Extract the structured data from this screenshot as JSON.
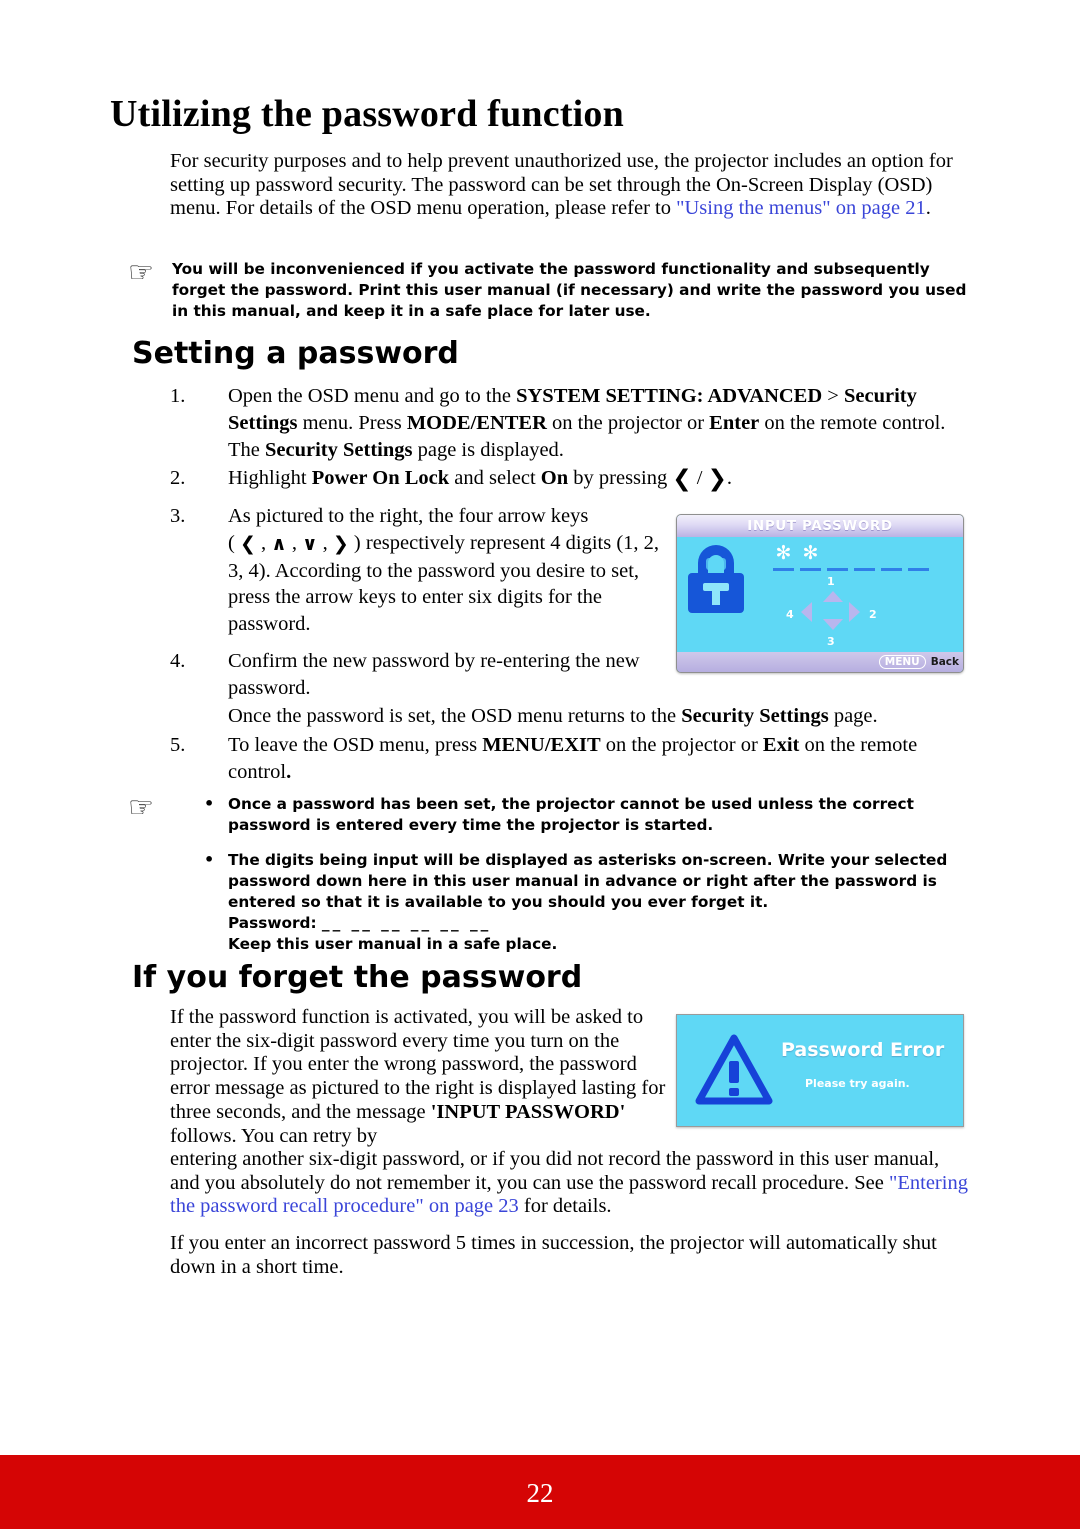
{
  "document": {
    "page_number": "22",
    "accent_color": "#d50505",
    "link_color": "#3a45d8",
    "osd_background": "#5fd8f5"
  },
  "headings": {
    "title": "Utilizing the password function",
    "setting_a_password": "Setting a password",
    "if_you_forget": "If you forget the password"
  },
  "intro": {
    "part1": "For security purposes and to help prevent unauthorized use, the projector includes an option for setting up password security. The password can be set through the On-Screen Display (OSD) menu. For details of the OSD menu operation, please refer to ",
    "link": "\"Using the menus\" on page 21",
    "part2": "."
  },
  "note1": {
    "icon": "pointing-hand-icon",
    "text": "You will be inconvenienced if you activate the password functionality and subsequently forget the password. Print this user manual (if necessary) and write the password you used in this manual, and keep it in a safe place for later use."
  },
  "steps": {
    "step1": {
      "num": "1.",
      "t1": "Open the OSD menu and go to the ",
      "b1": "SYSTEM SETTING: ADVANCED",
      "t2": " > ",
      "b2": "Security Settings",
      "t3": " menu. Press ",
      "b3": "MODE/ENTER",
      "t4": " on the projector or ",
      "b4": "Enter",
      "t5": " on the remote control. The ",
      "b5": "Security Settings",
      "t6": " page is displayed."
    },
    "step2": {
      "num": "2.",
      "t1": "Highlight ",
      "b1": "Power On Lock",
      "t2": " and select ",
      "b2": "On",
      "t3": " by pressing ",
      "arrow_left": "❮",
      "slash": " / ",
      "arrow_right": "❯",
      "t4": "."
    },
    "step3": {
      "num": "3.",
      "t1": "As pictured to the right, the four arrow keys",
      "open_paren": "( ",
      "a_left": "❮",
      "c1": " , ",
      "a_up": "∧",
      "c2": " , ",
      "a_down": "∨",
      "c3": " , ",
      "a_right": "❯",
      "close_paren": " ) ",
      "t2": "respectively represent 4 digits (1, 2, 3, 4). According to the password you desire to set, press the arrow keys to enter six digits for the password."
    },
    "step4": {
      "num": "4.",
      "t1": "Confirm the new password by re-entering the new password."
    },
    "step_once": {
      "t1": "Once the password is set, the OSD menu returns to the ",
      "b1": "Security Settings",
      "t2": " page."
    },
    "step5": {
      "num": "5.",
      "t1": "To leave the OSD menu, press ",
      "b1": "MENU/EXIT",
      "t2": " on the projector or ",
      "b2": "Exit",
      "t3": " on the remote control",
      "t4": "."
    }
  },
  "osd_input_password": {
    "title": "INPUT PASSWORD",
    "lock_icon": "padlock-icon",
    "slots": [
      {
        "filled": true,
        "char": "✻"
      },
      {
        "filled": true,
        "char": "✻"
      },
      {
        "filled": false,
        "char": ""
      },
      {
        "filled": false,
        "char": ""
      },
      {
        "filled": false,
        "char": ""
      },
      {
        "filled": false,
        "char": ""
      }
    ],
    "dpad": {
      "up_label": "1",
      "right_label": "2",
      "down_label": "3",
      "left_label": "4"
    },
    "footer": {
      "menu_key": "MENU",
      "action": "Back"
    }
  },
  "note2": {
    "icon": "pointing-hand-icon",
    "bullets": [
      "Once a password has been set, the projector cannot be used unless the correct password is entered every time the projector is started.",
      "The digits being input will be displayed as asterisks on-screen. Write your selected password down here in this user manual in advance or right after the password is entered so that it is available to you should you ever forget it."
    ],
    "password_label": "Password:",
    "password_blanks": "__ __ __ __ __ __",
    "keep_manual": "Keep this user manual in a safe place."
  },
  "forget_section": {
    "paragraph1_a": "If the password function is activated, you will be asked to enter the six-digit password every time you turn on the projector. If you enter the wrong password, the password error message as pictured to the right is displayed lasting for three seconds, and the message ",
    "paragraph1_bold": "'INPUT PASSWORD'",
    "paragraph1_b": " follows. You can retry by",
    "wrap_a": "entering another six-digit password, or if you did not record the password in this user manual, and you absolutely do not remember it, you can use the password recall procedure. See ",
    "wrap_link": "\"Entering the password recall procedure\" on page 23",
    "wrap_b": " for details.",
    "paragraph2": "If you enter an incorrect password 5 times in succession, the projector will automatically shut down in a short time."
  },
  "osd_password_error": {
    "warning_icon": "warning-triangle-icon",
    "title": "Password Error",
    "subtitle": "Please try again."
  }
}
